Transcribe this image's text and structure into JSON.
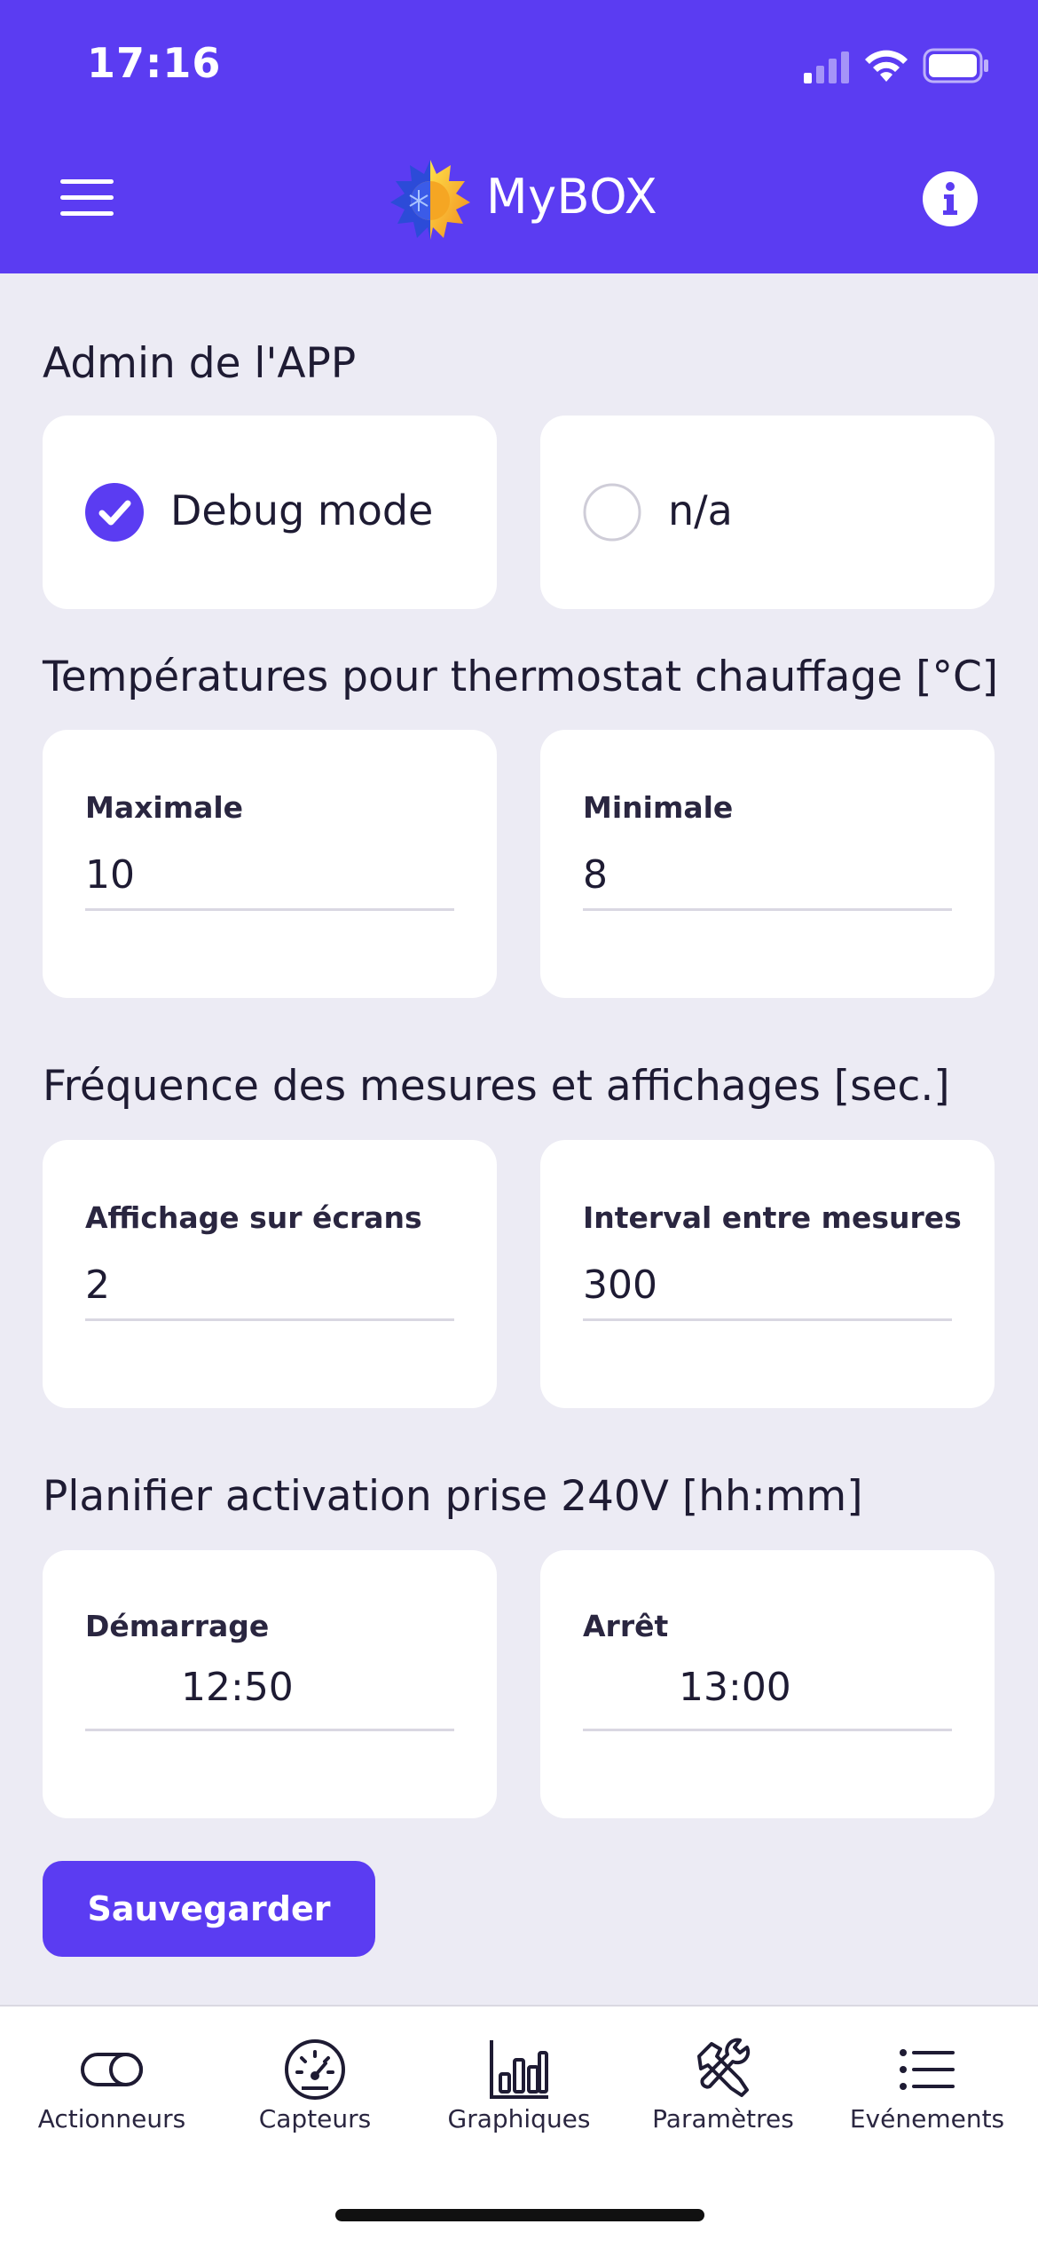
{
  "status_bar": {
    "time": "17:16"
  },
  "header": {
    "title": "MyBOX",
    "menu_icon": "hamburger-menu-icon",
    "info_icon": "info-icon",
    "brand_color": "#5B3CF2"
  },
  "sections": {
    "admin": {
      "title": "Admin de l'APP",
      "options": [
        {
          "label": "Debug mode",
          "checked": true
        },
        {
          "label": "n/a",
          "checked": false
        }
      ]
    },
    "thermostat": {
      "title": "Températures pour thermostat chauffage [°C]",
      "max_label": "Maximale",
      "max_value": "10",
      "min_label": "Minimale",
      "min_value": "8"
    },
    "frequency": {
      "title": "Fréquence des mesures et affichages [sec.]",
      "display_label": "Affichage sur écrans",
      "display_value": "2",
      "interval_label": "Interval entre mesures",
      "interval_value": "300"
    },
    "schedule": {
      "title": "Planifier activation prise 240V [hh:mm]",
      "start_label": "Démarrage",
      "start_value": "12:50",
      "stop_label": "Arrêt",
      "stop_value": "13:00"
    }
  },
  "save_button": {
    "label": "Sauvegarder"
  },
  "bottom_nav": {
    "items": [
      {
        "label": "Actionneurs",
        "icon": "toggle-icon"
      },
      {
        "label": "Capteurs",
        "icon": "gauge-icon"
      },
      {
        "label": "Graphiques",
        "icon": "bar-chart-icon"
      },
      {
        "label": "Paramètres",
        "icon": "tools-icon"
      },
      {
        "label": "Evénements",
        "icon": "list-icon"
      }
    ]
  }
}
